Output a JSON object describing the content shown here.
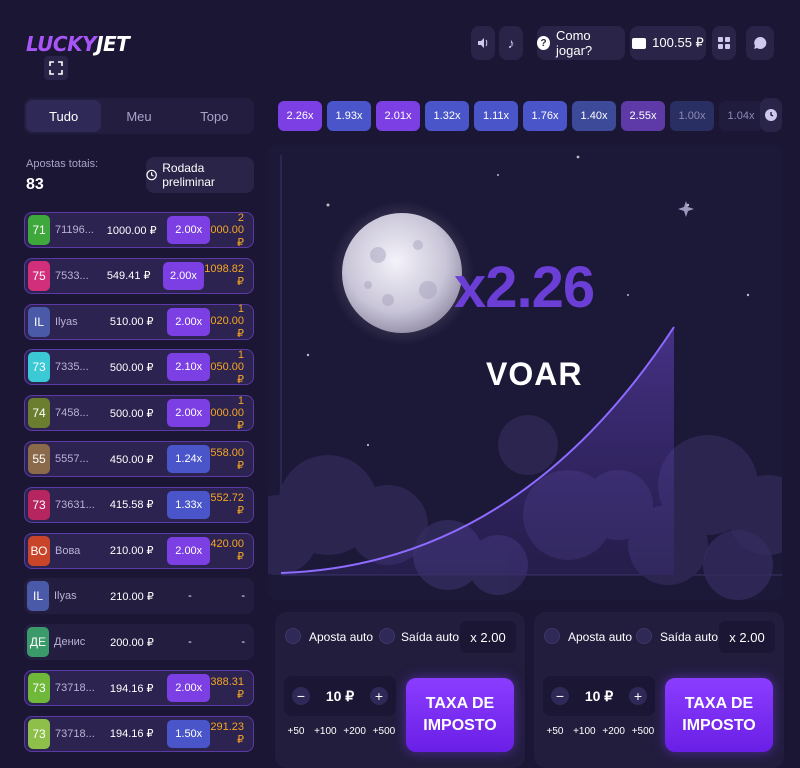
{
  "header": {
    "logo_part1": "LUCKY",
    "logo_part2": "JET",
    "how_to_play": "Como jogar?",
    "balance": "100.55 ₽"
  },
  "tabs": [
    "Tudo",
    "Meu",
    "Topo"
  ],
  "bets_summary": {
    "total_label": "Apostas totais:",
    "total_value": "83",
    "preliminary_button": "Rodada preliminar"
  },
  "bets": [
    {
      "avatar": "71",
      "avatar_color": "#3fa83c",
      "name": "71196...",
      "amount": "1000.00 ₽",
      "mult": "2.00x",
      "mult_color": "#7b3fe4",
      "win": "2 000.00 ₽"
    },
    {
      "avatar": "75",
      "avatar_color": "#d12f7c",
      "name": "7533...",
      "amount": "549.41 ₽",
      "mult": "2.00x",
      "mult_color": "#7b3fe4",
      "win": "1098.82 ₽"
    },
    {
      "avatar": "IL",
      "avatar_color": "#4a5aa8",
      "name": "Ilyas",
      "amount": "510.00 ₽",
      "mult": "2.00x",
      "mult_color": "#7b3fe4",
      "win": "1 020.00 ₽"
    },
    {
      "avatar": "73",
      "avatar_color": "#3bc9d6",
      "name": "7335...",
      "amount": "500.00 ₽",
      "mult": "2.10x",
      "mult_color": "#7b3fe4",
      "win": "1 050.00 ₽"
    },
    {
      "avatar": "74",
      "avatar_color": "#6b7d2e",
      "name": "7458...",
      "amount": "500.00 ₽",
      "mult": "2.00x",
      "mult_color": "#7b3fe4",
      "win": "1 000.00 ₽"
    },
    {
      "avatar": "55",
      "avatar_color": "#8a6a4a",
      "name": "5557...",
      "amount": "450.00 ₽",
      "mult": "1.24x",
      "mult_color": "#4a55c9",
      "win": "558.00 ₽"
    },
    {
      "avatar": "73",
      "avatar_color": "#b52660",
      "name": "73631...",
      "amount": "415.58 ₽",
      "mult": "1.33x",
      "mult_color": "#4a55c9",
      "win": "552.72 ₽"
    },
    {
      "avatar": "ВО",
      "avatar_color": "#c9452a",
      "name": "Вова",
      "amount": "210.00 ₽",
      "mult": "2.00x",
      "mult_color": "#7b3fe4",
      "win": "420.00 ₽"
    },
    {
      "avatar": "IL",
      "avatar_color": "#4a5aa8",
      "name": "Ilyas",
      "amount": "210.00 ₽",
      "mult": "-",
      "mult_color": "",
      "win": "-"
    },
    {
      "avatar": "ДЕ",
      "avatar_color": "#3b9a6a",
      "name": "Денис",
      "amount": "200.00 ₽",
      "mult": "-",
      "mult_color": "",
      "win": "-"
    },
    {
      "avatar": "73",
      "avatar_color": "#6fb83a",
      "name": "73718...",
      "amount": "194.16 ₽",
      "mult": "2.00x",
      "mult_color": "#7b3fe4",
      "win": "388.31 ₽"
    },
    {
      "avatar": "73",
      "avatar_color": "#8ebf4a",
      "name": "73718...",
      "amount": "194.16 ₽",
      "mult": "1.50x",
      "mult_color": "#4a55c9",
      "win": "291.23 ₽"
    }
  ],
  "history": [
    {
      "v": "2.26x",
      "c": "#7b3fe4"
    },
    {
      "v": "1.93x",
      "c": "#4a55c9"
    },
    {
      "v": "2.01x",
      "c": "#7b3fe4"
    },
    {
      "v": "1.32x",
      "c": "#4a55c9"
    },
    {
      "v": "1.11x",
      "c": "#4a55c9"
    },
    {
      "v": "1.76x",
      "c": "#4a55c9"
    },
    {
      "v": "1.40x",
      "c": "#3d4a9a"
    },
    {
      "v": "2.55x",
      "c": "#5e3aa8"
    },
    {
      "v": "1.00x",
      "c": "#2a2f63"
    },
    {
      "v": "1.04x",
      "c": "#1f1c3d"
    }
  ],
  "game": {
    "multiplier": "x2.26",
    "status": "VOAR"
  },
  "panels": [
    {
      "auto_bet": "Aposta auto",
      "auto_cashout": "Saída auto",
      "cashout_value": "x 2.00",
      "bet_value": "10 ₽",
      "quick": [
        "+50",
        "+100",
        "+200",
        "+500"
      ],
      "button_line1": "TAXA DE",
      "button_line2": "IMPOSTO"
    },
    {
      "auto_bet": "Aposta auto",
      "auto_cashout": "Saída auto",
      "cashout_value": "x 2.00",
      "bet_value": "10 ₽",
      "quick": [
        "+50",
        "+100",
        "+200",
        "+500"
      ],
      "button_line1": "TAXA DE",
      "button_line2": "IMPOSTO"
    }
  ]
}
